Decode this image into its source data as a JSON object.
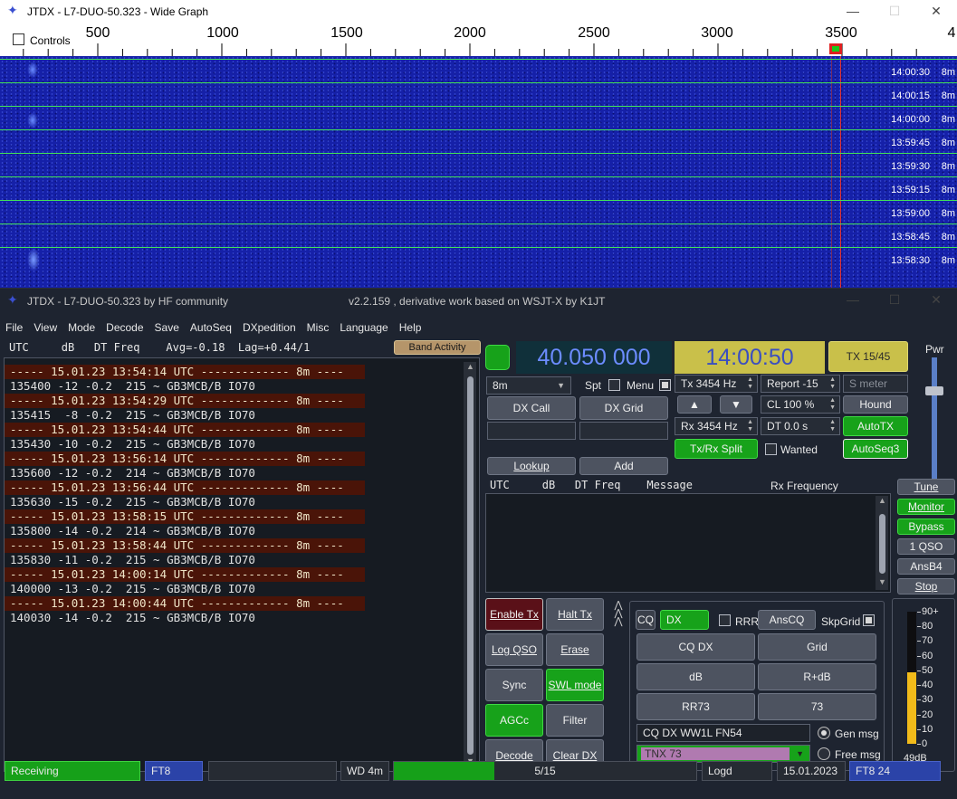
{
  "wide_graph": {
    "title": "JTDX - L7-DUO-50.323 - Wide Graph",
    "controls_label": "Controls",
    "ruler_labels": [
      "500",
      "1000",
      "1500",
      "2000",
      "2500",
      "3000",
      "3500",
      "4"
    ],
    "rows": [
      {
        "time": "14:00:30",
        "band": "8m"
      },
      {
        "time": "14:00:15",
        "band": "8m"
      },
      {
        "time": "14:00:00",
        "band": "8m"
      },
      {
        "time": "13:59:45",
        "band": "8m"
      },
      {
        "time": "13:59:30",
        "band": "8m"
      },
      {
        "time": "13:59:15",
        "band": "8m"
      },
      {
        "time": "13:59:00",
        "band": "8m"
      },
      {
        "time": "13:58:45",
        "band": "8m"
      },
      {
        "time": "13:58:30",
        "band": "8m"
      }
    ]
  },
  "main": {
    "title": "JTDX - L7-DUO-50.323  by HF community",
    "version": "v2.2.159 , derivative work based on WSJT-X by K1JT",
    "menu": [
      "File",
      "View",
      "Mode",
      "Decode",
      "Save",
      "AutoSeq",
      "DXpedition",
      "Misc",
      "Language",
      "Help"
    ],
    "band_header": "UTC     dB   DT Freq    Avg=-0.18  Lag=+0.44/1",
    "band_activity_btn": "Band Activity",
    "log": [
      {
        "t": "sep",
        "text": "----- 15.01.23 13:54:14 UTC ------------- 8m ----"
      },
      {
        "t": "msg",
        "text": "135400 -12 -0.2  215 ~ GB3MCB/B IO70"
      },
      {
        "t": "sep",
        "text": "----- 15.01.23 13:54:29 UTC ------------- 8m ----"
      },
      {
        "t": "msg",
        "text": "135415  -8 -0.2  215 ~ GB3MCB/B IO70"
      },
      {
        "t": "sep",
        "text": "----- 15.01.23 13:54:44 UTC ------------- 8m ----"
      },
      {
        "t": "msg",
        "text": "135430 -10 -0.2  215 ~ GB3MCB/B IO70"
      },
      {
        "t": "sep",
        "text": "----- 15.01.23 13:56:14 UTC ------------- 8m ----"
      },
      {
        "t": "msg",
        "text": "135600 -12 -0.2  214 ~ GB3MCB/B IO70"
      },
      {
        "t": "sep",
        "text": "----- 15.01.23 13:56:44 UTC ------------- 8m ----"
      },
      {
        "t": "msg",
        "text": "135630 -15 -0.2  215 ~ GB3MCB/B IO70"
      },
      {
        "t": "sep",
        "text": "----- 15.01.23 13:58:15 UTC ------------- 8m ----"
      },
      {
        "t": "msg",
        "text": "135800 -14 -0.2  214 ~ GB3MCB/B IO70"
      },
      {
        "t": "sep",
        "text": "----- 15.01.23 13:58:44 UTC ------------- 8m ----"
      },
      {
        "t": "msg",
        "text": "135830 -11 -0.2  215 ~ GB3MCB/B IO70"
      },
      {
        "t": "sep",
        "text": "----- 15.01.23 14:00:14 UTC ------------- 8m ----"
      },
      {
        "t": "msg",
        "text": "140000 -13 -0.2  215 ~ GB3MCB/B IO70"
      },
      {
        "t": "sep",
        "text": "----- 15.01.23 14:00:44 UTC ------------- 8m ----"
      },
      {
        "t": "msg",
        "text": "140030 -14 -0.2  215 ~ GB3MCB/B IO70"
      }
    ],
    "frequency": "40.050 000",
    "clock": "14:00:50",
    "tx_period": "TX 15/45",
    "pwr_label": "Pwr",
    "band_select": "8m",
    "spt": "Spt",
    "menu_chk": "Menu",
    "tx_freq": "Tx  3454  Hz",
    "rx_freq": "Rx  3454  Hz",
    "report": "Report -15",
    "smeter": "S meter",
    "cl": "CL  100 %",
    "dt": "DT 0.0 s",
    "dxcall_btn": "DX Call",
    "dxgrid_btn": "DX Grid",
    "hound": "Hound",
    "autotx": "AutoTX",
    "autoseq3": "AutoSeq3",
    "txrxsplit": "Tx/Rx Split",
    "wanted": "Wanted",
    "lookup": "Lookup",
    "add": "Add",
    "rx_header": "UTC     dB   DT Freq    Message",
    "rx_freq_header": "Rx Frequency",
    "right_buttons": [
      "Tune",
      "Monitor",
      "Bypass",
      "1 QSO",
      "AnsB4",
      "Stop"
    ],
    "left_buttons": [
      "Enable Tx",
      "Halt Tx",
      "Log QSO",
      "Erase",
      "Sync",
      "SWL mode",
      "AGCc",
      "Filter",
      "Decode",
      "Clear DX"
    ],
    "cq": "CQ",
    "dx": "DX",
    "rrr": "RRR",
    "anscq": "AnsCQ",
    "skpgrid": "SkpGrid",
    "msg_buttons": [
      "CQ DX",
      "Grid",
      "dB",
      "R+dB",
      "RR73",
      "73"
    ],
    "gen_message": "CQ DX WW1L FN54",
    "gen_msg_label": "Gen msg",
    "free_message": "TNX 73",
    "free_msg_label": "Free msg",
    "meter_ticks": [
      "90+",
      "80",
      "70",
      "60",
      "50",
      "40",
      "30",
      "20",
      "10",
      "0"
    ],
    "meter_db": "49dB",
    "meter_level": 49,
    "status": {
      "state": "Receiving",
      "mode": "FT8",
      "wd": "WD 4m",
      "progress": "5/15",
      "progress_frac": 0.333,
      "logd": "Logd",
      "date": "15.01.2023",
      "mode_count": "FT8  24"
    }
  }
}
